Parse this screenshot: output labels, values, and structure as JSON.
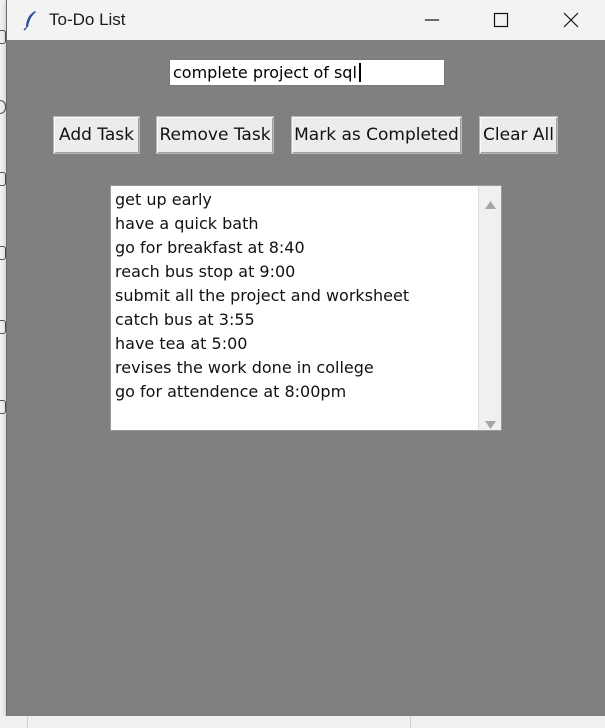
{
  "window": {
    "title": "To-Do List",
    "icon": "feather-icon",
    "controls": [
      "minimize-icon",
      "maximize-icon",
      "close-icon"
    ]
  },
  "entry": {
    "value": "complete project of sql"
  },
  "buttons": {
    "add": "Add Task",
    "remove": "Remove Task",
    "complete": "Mark as Completed",
    "clear": "Clear All"
  },
  "tasks": [
    "get up early",
    "have a quick bath",
    "go for breakfast at 8:40",
    "reach bus stop at 9:00",
    "submit all the project and worksheet",
    "catch bus at 3:55",
    "have tea at 5:00",
    "revises the work done in college",
    "go for attendence at 8:00pm"
  ],
  "colors": {
    "window_bg": "#808080",
    "titlebar_bg": "#f3f3f3",
    "button_bg": "#ececec",
    "list_bg": "#ffffff"
  }
}
